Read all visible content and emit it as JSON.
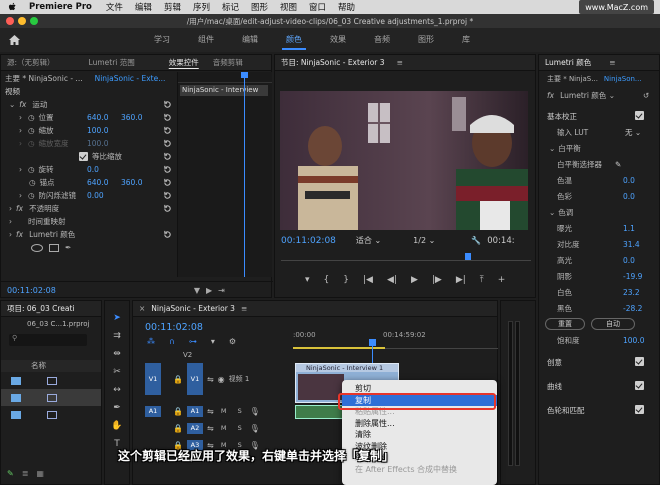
{
  "menubar": {
    "app_name": "Premiere Pro",
    "items": [
      "文件",
      "编辑",
      "剪辑",
      "序列",
      "标记",
      "图形",
      "视图",
      "窗口",
      "帮助"
    ],
    "watermark": "www.MacZ.com"
  },
  "titlebar": {
    "title": "/用户/mac/桌面/edit-adjust-video-clips/06_03 Creative adjustments_1.prproj *"
  },
  "workspace": {
    "tabs": [
      "学习",
      "组件",
      "编辑",
      "颜色",
      "效果",
      "音频",
      "图形",
      "库"
    ],
    "active": "颜色"
  },
  "source_panel": {
    "tabs": [
      "源:（无剪辑）",
      "Lumetri 范围",
      "效果控件",
      "音频剪辑"
    ],
    "master_label": "主要 * NinjaSonic - ...",
    "clip_label": "NinjaSonic - Exte...",
    "clip_chip": "NinjaSonic - Interview",
    "section_video": "视频",
    "motion": "运动",
    "position_label": "位置",
    "position_x": "640.0",
    "position_y": "360.0",
    "scale_label": "缩放",
    "scale_value": "100.0",
    "scale_width_label": "缩放宽度",
    "scale_width_value": "100.0",
    "uniform_scale": "等比缩放",
    "rotation_label": "旋转",
    "rotation_value": "0.0",
    "anchor_label": "锚点",
    "anchor_x": "640.0",
    "anchor_y": "360.0",
    "anti_flicker_label": "防闪烁滤镜",
    "anti_flicker_value": "0.00",
    "opacity": "不透明度",
    "time_remap": "时间重映射",
    "lumetri": "Lumetri 颜色",
    "timecode": "00:11:02:08"
  },
  "program_monitor": {
    "title": "节目: NinjaSonic - Exterior 3",
    "timecode": "00:11:02:08",
    "fit": "适合",
    "quality": "1/2",
    "end_timecode": "00:14:"
  },
  "lumetri_panel": {
    "tab": "Lumetri 颜色",
    "clip_master": "主要 * NinjaS...",
    "clip_seq": "NinjaSon...",
    "fx_label": "Lumetri 颜色",
    "basic": "基本校正",
    "input_lut": "输入 LUT",
    "input_lut_value": "无",
    "white_balance": "白平衡",
    "wb_selector": "白平衡选择器",
    "temp": "色温",
    "temp_value": "0.0",
    "tint": "色彩",
    "tint_value": "0.0",
    "tone": "色调",
    "exposure": "曝光",
    "exposure_value": "1.1",
    "contrast": "对比度",
    "contrast_value": "31.4",
    "highlights": "高光",
    "highlights_value": "0.0",
    "shadows": "阴影",
    "shadows_value": "-19.9",
    "whites": "白色",
    "whites_value": "23.2",
    "blacks": "黑色",
    "blacks_value": "-28.2",
    "reset": "重置",
    "auto": "自动",
    "saturation": "饱和度",
    "saturation_value": "100.0",
    "creative": "创意",
    "curves": "曲线",
    "color_wheels": "色轮和匹配"
  },
  "project_panel": {
    "tab": "项目: 06_03 Creati",
    "file": "06_03 C...1.prproj",
    "column_name": "名称"
  },
  "timeline": {
    "tab": "NinjaSonic - Exterior 3",
    "timecode": "00:11:02:08",
    "ruler_start": ":00:00",
    "ruler_mid": "00:14:59:02",
    "tracks": {
      "v2": "V2",
      "v1": "V1",
      "v1_src": "V1",
      "v1_name": "视频 1",
      "a1": "A1",
      "a1_src": "A1",
      "a2": "A2",
      "a3": "A3",
      "m": "M",
      "s": "S"
    },
    "clip_label": "NinjaSonic - Interview 1"
  },
  "context_menu": {
    "items": [
      {
        "label": "剪切",
        "state": "normal"
      },
      {
        "label": "复制",
        "state": "selected"
      },
      {
        "label": "粘贴属性...",
        "state": "disabled"
      },
      {
        "label": "删除属性...",
        "state": "normal"
      },
      {
        "label": "清除",
        "state": "normal"
      },
      {
        "label": "波纹删除",
        "state": "normal"
      },
      {
        "label": "编辑原始",
        "state": "normal"
      },
      {
        "label": "在 After Effects 合成中替换",
        "state": "disabled"
      }
    ]
  },
  "caption": "这个剪辑已经应用了效果，右键单击并选择「复制」"
}
